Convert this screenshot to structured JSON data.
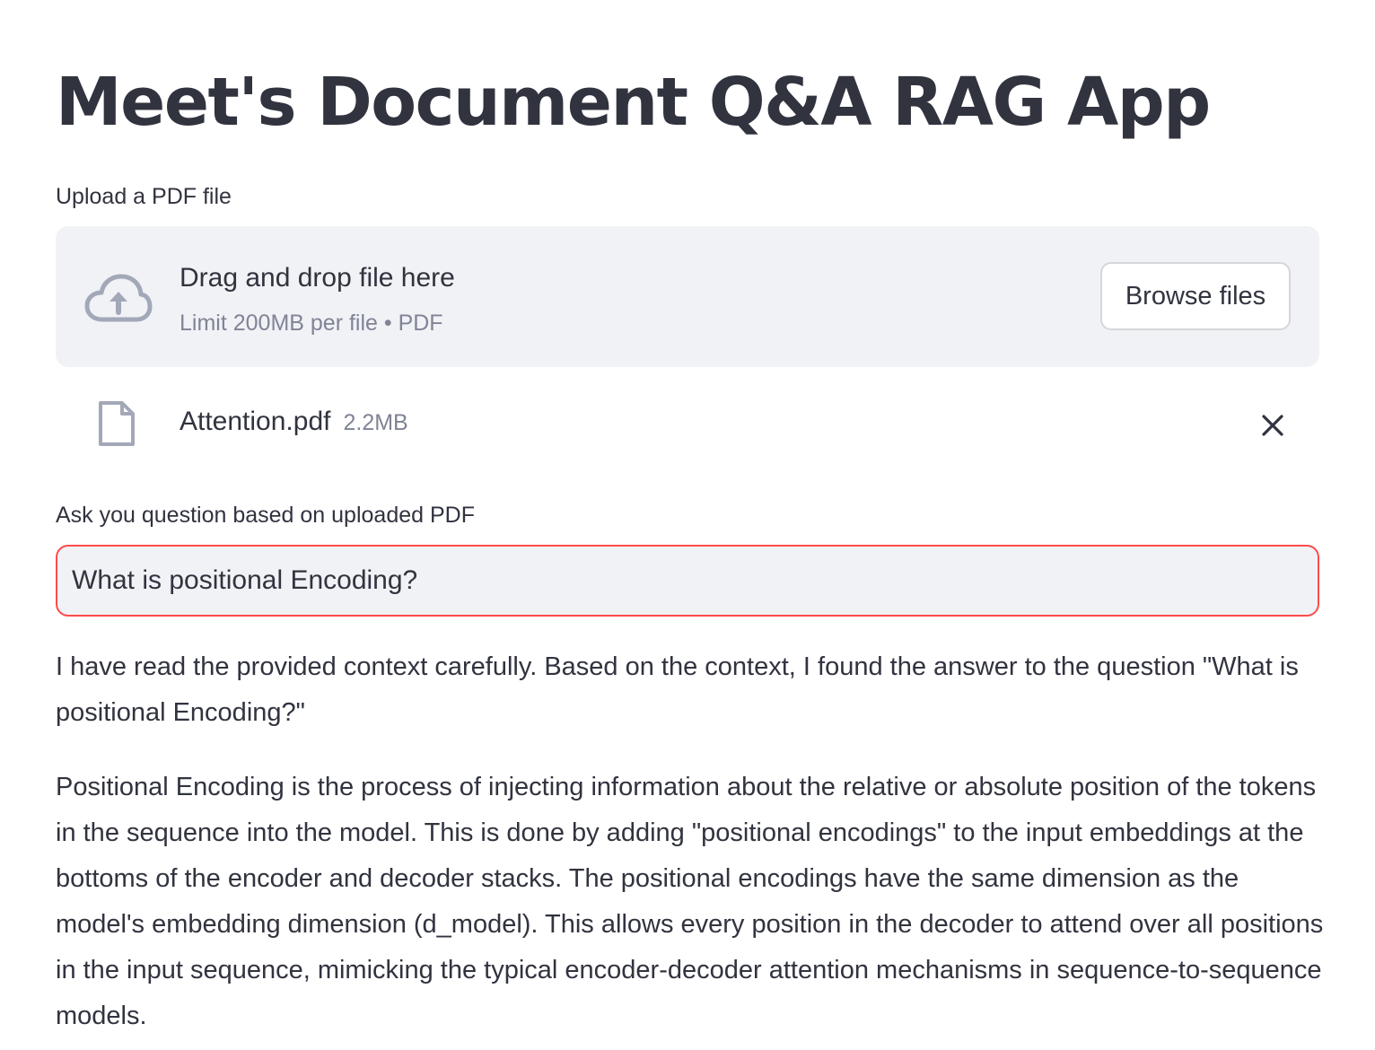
{
  "app": {
    "title": "Meet's Document Q&A RAG App"
  },
  "uploader": {
    "label": "Upload a PDF file",
    "dropzone_title": "Drag and drop file here",
    "dropzone_subtitle": "Limit 200MB per file • PDF",
    "browse_label": "Browse files",
    "icon": "cloud-upload-icon",
    "file": {
      "name": "Attention.pdf",
      "size": "2.2MB",
      "icon": "file-icon",
      "remove_icon": "close-icon"
    }
  },
  "question": {
    "label": "Ask you question based on uploaded PDF",
    "value": "What is positional Encoding?"
  },
  "answer": {
    "paragraphs": [
      "I have read the provided context carefully. Based on the context, I found the answer to the question \"What is positional Encoding?\"",
      "Positional Encoding is the process of injecting information about the relative or absolute position of the tokens in the sequence into the model. This is done by adding \"positional encodings\" to the input embeddings at the bottoms of the encoder and decoder stacks. The positional encodings have the same dimension as the model's embedding dimension (d_model). This allows every position in the decoder to attend over all positions in the input sequence, mimicking the typical encoder-decoder attention mechanisms in sequence-to-sequence models."
    ]
  },
  "colors": {
    "text": "#31333f",
    "muted_text": "#808495",
    "dropzone_bg": "#f0f2f6",
    "input_focus_border": "#ff4b4b",
    "icon": "#a3a8b8"
  }
}
